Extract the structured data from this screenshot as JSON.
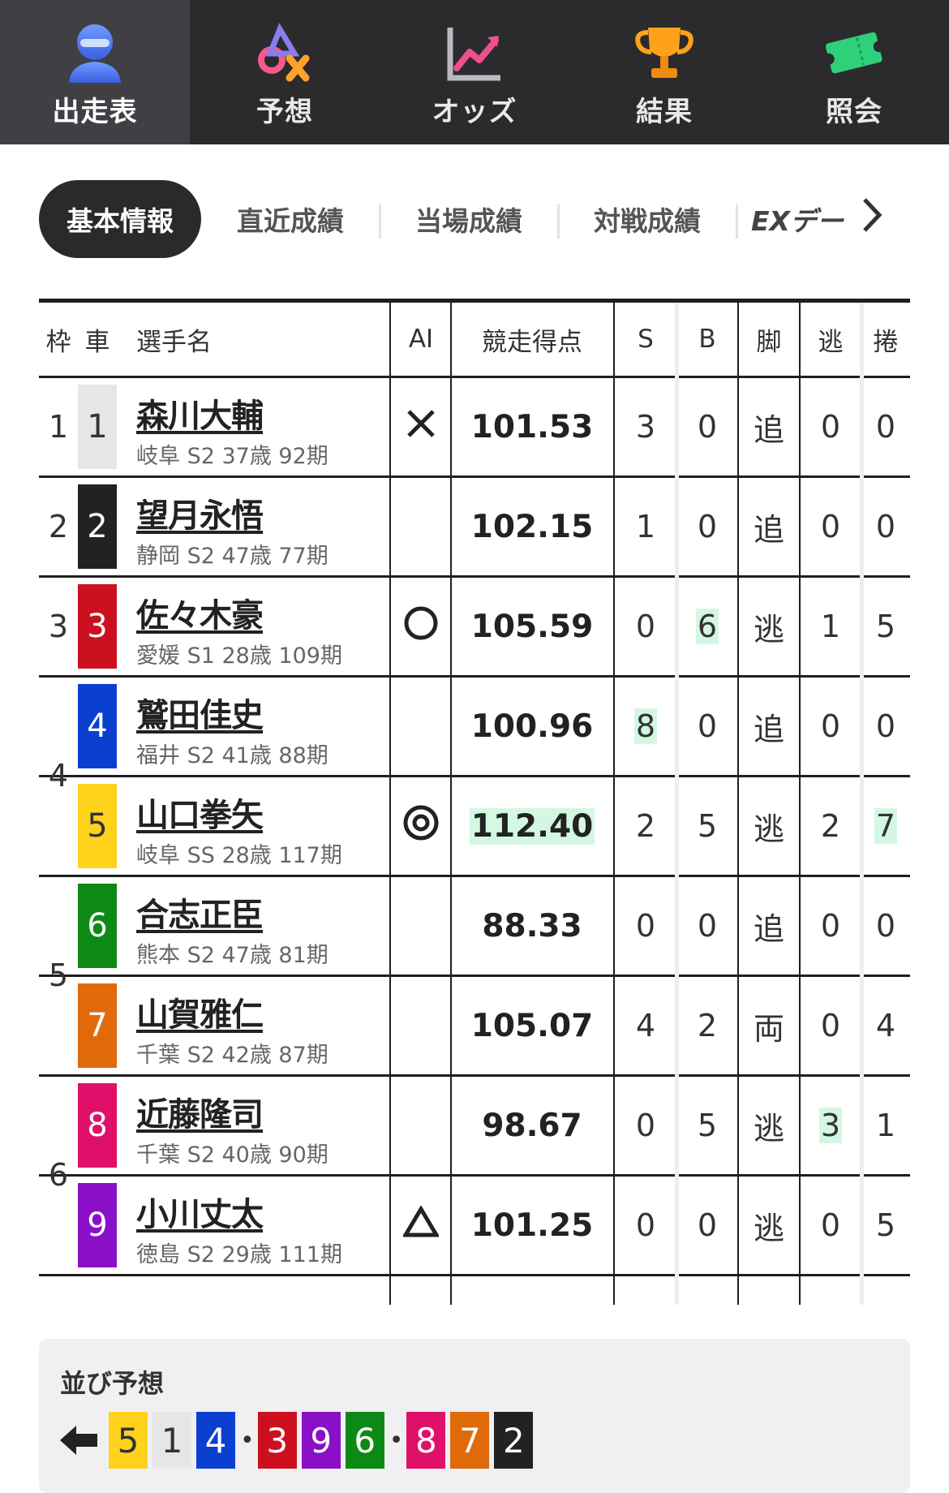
{
  "nav": {
    "items": [
      {
        "label": "出走表",
        "icon": "racer-helmet-icon",
        "active": true
      },
      {
        "label": "予想",
        "icon": "prediction-marks-icon",
        "active": false
      },
      {
        "label": "オッズ",
        "icon": "odds-chart-icon",
        "active": false
      },
      {
        "label": "結果",
        "icon": "trophy-icon",
        "active": false
      },
      {
        "label": "照会",
        "icon": "ticket-icon",
        "active": false
      }
    ]
  },
  "subtabs": {
    "items": [
      "基本情報",
      "直近成績",
      "当場成績",
      "対戦成績",
      "EXデー"
    ],
    "active": "基本情報"
  },
  "table": {
    "headers": {
      "waku": "枠",
      "sha": "車",
      "name": "選手名",
      "ai": "AI",
      "score": "競走得点",
      "s": "S",
      "b": "B",
      "kyaku": "脚",
      "nige": "逃",
      "makuri": "捲"
    },
    "waku_labels": [
      "1",
      "2",
      "3",
      "4",
      "5",
      "6"
    ],
    "rows": [
      {
        "sha": "1",
        "name": "森川大輔",
        "info": "岐阜 S2 37歳 92期",
        "ai": "×",
        "score": "101.53",
        "s": "3",
        "b": "0",
        "kyaku": "追",
        "nige": "0",
        "makuri": "0",
        "color": "#e6e6e9",
        "textColor": "#333333"
      },
      {
        "sha": "2",
        "name": "望月永悟",
        "info": "静岡 S2 47歳 77期",
        "ai": "",
        "score": "102.15",
        "s": "1",
        "b": "0",
        "kyaku": "追",
        "nige": "0",
        "makuri": "0",
        "color": "#222222",
        "textColor": "#ffffff"
      },
      {
        "sha": "3",
        "name": "佐々木豪",
        "info": "愛媛 S1 28歳 109期",
        "ai": "○",
        "score": "105.59",
        "s": "0",
        "b": "6",
        "kyaku": "逃",
        "nige": "1",
        "makuri": "5",
        "color": "#cc1020",
        "textColor": "#ffffff"
      },
      {
        "sha": "4",
        "name": "鷲田佳史",
        "info": "福井 S2 41歳 88期",
        "ai": "",
        "score": "100.96",
        "s": "8",
        "b": "0",
        "kyaku": "追",
        "nige": "0",
        "makuri": "0",
        "color": "#0a3fd0",
        "textColor": "#ffffff"
      },
      {
        "sha": "5",
        "name": "山口拳矢",
        "info": "岐阜 SS 28歳 117期",
        "ai": "◎",
        "score": "112.40",
        "s": "2",
        "b": "5",
        "kyaku": "逃",
        "nige": "2",
        "makuri": "7",
        "color": "#ffd21c",
        "textColor": "#333333"
      },
      {
        "sha": "6",
        "name": "合志正臣",
        "info": "熊本 S2 47歳 81期",
        "ai": "",
        "score": "88.33",
        "s": "0",
        "b": "0",
        "kyaku": "追",
        "nige": "0",
        "makuri": "0",
        "color": "#0d8a16",
        "textColor": "#ffffff"
      },
      {
        "sha": "7",
        "name": "山賀雅仁",
        "info": "千葉 S2 42歳 87期",
        "ai": "",
        "score": "105.07",
        "s": "4",
        "b": "2",
        "kyaku": "両",
        "nige": "0",
        "makuri": "4",
        "color": "#e06a0a",
        "textColor": "#ffffff"
      },
      {
        "sha": "8",
        "name": "近藤隆司",
        "info": "千葉 S2 40歳 90期",
        "ai": "",
        "score": "98.67",
        "s": "0",
        "b": "5",
        "kyaku": "逃",
        "nige": "3",
        "makuri": "1",
        "color": "#e0106a",
        "textColor": "#ffffff"
      },
      {
        "sha": "9",
        "name": "小川丈太",
        "info": "徳島 S2 29歳 111期",
        "ai": "△",
        "score": "101.25",
        "s": "0",
        "b": "0",
        "kyaku": "逃",
        "nige": "0",
        "makuri": "5",
        "color": "#8a10c8",
        "textColor": "#ffffff"
      }
    ],
    "highlights": [
      "r2.b",
      "r3.s",
      "r4.score",
      "r4.makuri",
      "r7.nige"
    ],
    "highlight_color": "#d4f7e4"
  },
  "narabi": {
    "title": "並び予想",
    "arrow": "left-arrow-icon",
    "sequence": [
      "5",
      "1",
      "4",
      "•",
      "3",
      "9",
      "6",
      "•",
      "8",
      "7",
      "2"
    ]
  }
}
